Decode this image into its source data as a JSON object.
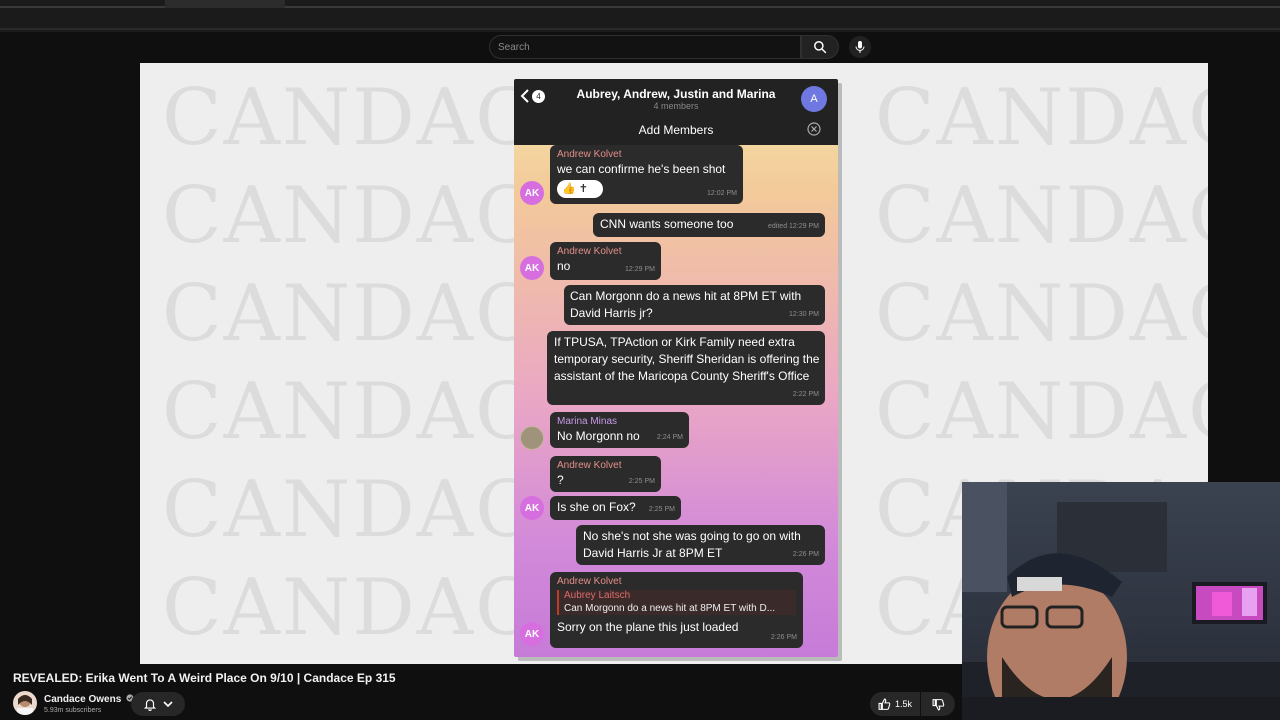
{
  "search": {
    "placeholder": "Search"
  },
  "watermark": {
    "text": "CANDACE"
  },
  "telegram": {
    "back_count": "4",
    "title": "Aubrey, Andrew, Justin and Marina",
    "members": "4 members",
    "avatar_letter": "A",
    "add_members": "Add Members",
    "messages": [
      {
        "sender": "Andrew Kolvet",
        "text": "we can confirme he's been shot",
        "time": "12:02 PM",
        "avatar": "AK"
      },
      {
        "text": "CNN wants someone too",
        "time": "edited 12:29 PM"
      },
      {
        "sender": "Andrew Kolvet",
        "text": "no",
        "time": "12:29 PM",
        "avatar": "AK"
      },
      {
        "text": "Can Morgonn do a news hit at 8PM ET with David Harris jr?",
        "time": "12:30 PM"
      },
      {
        "text": "If TPUSA, TPAction or Kirk Family need extra temporary security, Sheriff Sheridan is offering the assistant of the Maricopa County Sheriff's Office",
        "time": "2:22 PM"
      },
      {
        "sender": "Marina Minas",
        "text": "No Morgonn no",
        "time": "2:24 PM"
      },
      {
        "sender": "Andrew Kolvet",
        "text": "?",
        "time": "2:25 PM"
      },
      {
        "text": "Is she on Fox?",
        "time": "2:25 PM",
        "avatar": "AK"
      },
      {
        "text": "No she's not she was going to go on with David Harris Jr at 8PM ET",
        "time": "2:26 PM"
      },
      {
        "sender": "Andrew Kolvet",
        "reply_name": "Aubrey Laitsch",
        "reply_text": "Can Morgonn do a news hit at 8PM ET with D...",
        "text": "Sorry on the plane this just loaded",
        "time": "2:26 PM",
        "avatar": "AK"
      }
    ]
  },
  "video": {
    "title": "REVEALED: Erika Went To A Weird Place On 9/10 | Candace Ep 315",
    "channel": "Candace Owens",
    "subscribers": "5.93m subscribers",
    "likes": "1.5k"
  },
  "icons": [
    "search-icon",
    "mic-icon",
    "back-chevron-icon",
    "close-icon",
    "bell-icon",
    "chevron-down-icon",
    "thumbs-up-icon",
    "thumbs-down-icon",
    "verified-icon"
  ]
}
